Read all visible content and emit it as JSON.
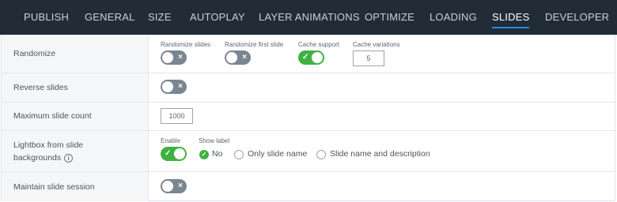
{
  "tabs": [
    {
      "label": "PUBLISH"
    },
    {
      "label": "GENERAL"
    },
    {
      "label": "SIZE"
    },
    {
      "label": "AUTOPLAY"
    },
    {
      "label": "LAYER ANIMATIONS"
    },
    {
      "label": "OPTIMIZE"
    },
    {
      "label": "LOADING"
    },
    {
      "label": "SLIDES",
      "active": true
    },
    {
      "label": "DEVELOPER"
    }
  ],
  "rows": {
    "randomize": {
      "label": "Randomize",
      "randomize_slides": {
        "label": "Randomize slides",
        "checked": false
      },
      "randomize_first": {
        "label": "Randomize first slide",
        "checked": false
      },
      "cache_support": {
        "label": "Cache support",
        "checked": true
      },
      "cache_variations": {
        "label": "Cache variations",
        "value": "5"
      }
    },
    "reverse": {
      "label": "Reverse slides",
      "checked": false
    },
    "max_count": {
      "label": "Maximum slide count",
      "value": "1000"
    },
    "lightbox": {
      "label_line1": "Lightbox from slide",
      "label_line2": "backgrounds",
      "enable": {
        "label": "Enable",
        "checked": true
      },
      "show_label": {
        "label": "Show label",
        "options": [
          "No",
          "Only slide name",
          "Slide name and description"
        ],
        "selected": "No"
      }
    },
    "session": {
      "label": "Maintain slide session",
      "checked": false
    }
  },
  "icons": {
    "toggle_off": "×",
    "toggle_on": "✓",
    "info": "i"
  },
  "colors": {
    "topbar": "#222c36",
    "accent": "#1d8cf2",
    "toggle_on": "#3fb142",
    "toggle_off": "#7a8690"
  }
}
